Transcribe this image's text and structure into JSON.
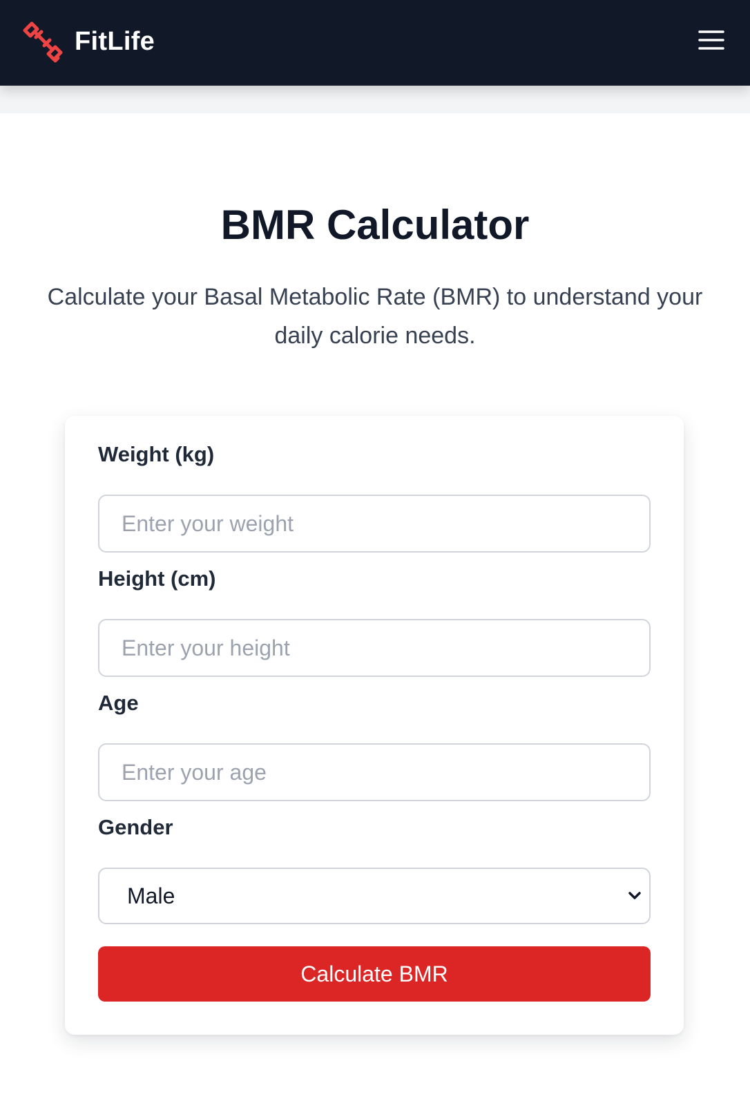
{
  "nav": {
    "brand": "FitLife",
    "logo_icon": "dumbbell-icon",
    "menu_icon": "hamburger-menu-icon"
  },
  "hero": {
    "title": "BMR Calculator",
    "subtitle": "Calculate your Basal Metabolic Rate (BMR) to understand your daily calorie needs."
  },
  "form": {
    "weight": {
      "label": "Weight (kg)",
      "placeholder": "Enter your weight",
      "value": ""
    },
    "height": {
      "label": "Height (cm)",
      "placeholder": "Enter your height",
      "value": ""
    },
    "age": {
      "label": "Age",
      "placeholder": "Enter your age",
      "value": ""
    },
    "gender": {
      "label": "Gender",
      "selected": "Male"
    },
    "submit_label": "Calculate BMR"
  },
  "colors": {
    "navbar_bg": "#111827",
    "accent": "#dc2626",
    "logo": "#ef4444"
  }
}
